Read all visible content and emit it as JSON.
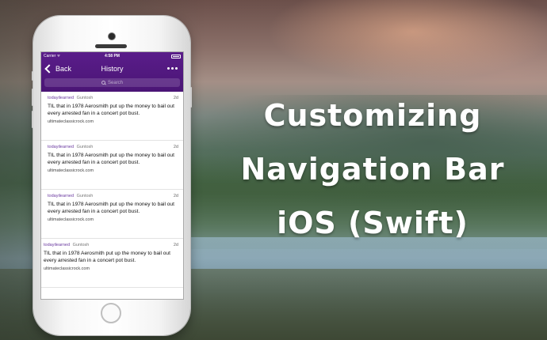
{
  "headline": {
    "line1": "Customizing",
    "line2": "Navigation Bar",
    "line3": "iOS (Swift)"
  },
  "phone": {
    "status_bar": {
      "carrier": "Carrier ᯤ",
      "time": "4:58 PM"
    },
    "nav_bar": {
      "back_label": "Back",
      "title": "History",
      "search_placeholder": "Search",
      "more_icon": "ellipsis-icon",
      "background_color": "#4e1878"
    },
    "posts": [
      {
        "subreddit": "todayilearned",
        "user": "Guntosh",
        "age": "2d",
        "title": "TIL that in 1978 Aerosmith put up the money to bail out every arrested fan in a concert pot bust.",
        "domain": "ultimateclassicrock.com"
      },
      {
        "subreddit": "todayilearned",
        "user": "Guntosh",
        "age": "2d",
        "title": "TIL that in 1978 Aerosmith put up the money to bail out every arrested fan in a concert pot bust.",
        "domain": "ultimateclassicrock.com"
      },
      {
        "subreddit": "todayilearned",
        "user": "Guntosh",
        "age": "2d",
        "title": "TIL that in 1978 Aerosmith put up the money to bail out every arrested fan in a concert pot bust.",
        "domain": "ultimateclassicrock.com"
      },
      {
        "subreddit": "todayilearned",
        "user": "Guntosh",
        "age": "2d",
        "title": "TIL that in 1978 Aerosmith put up the money to bail out every arrested fan in a concert pot bust.",
        "domain": "ultimateclassicrock.com"
      }
    ]
  }
}
